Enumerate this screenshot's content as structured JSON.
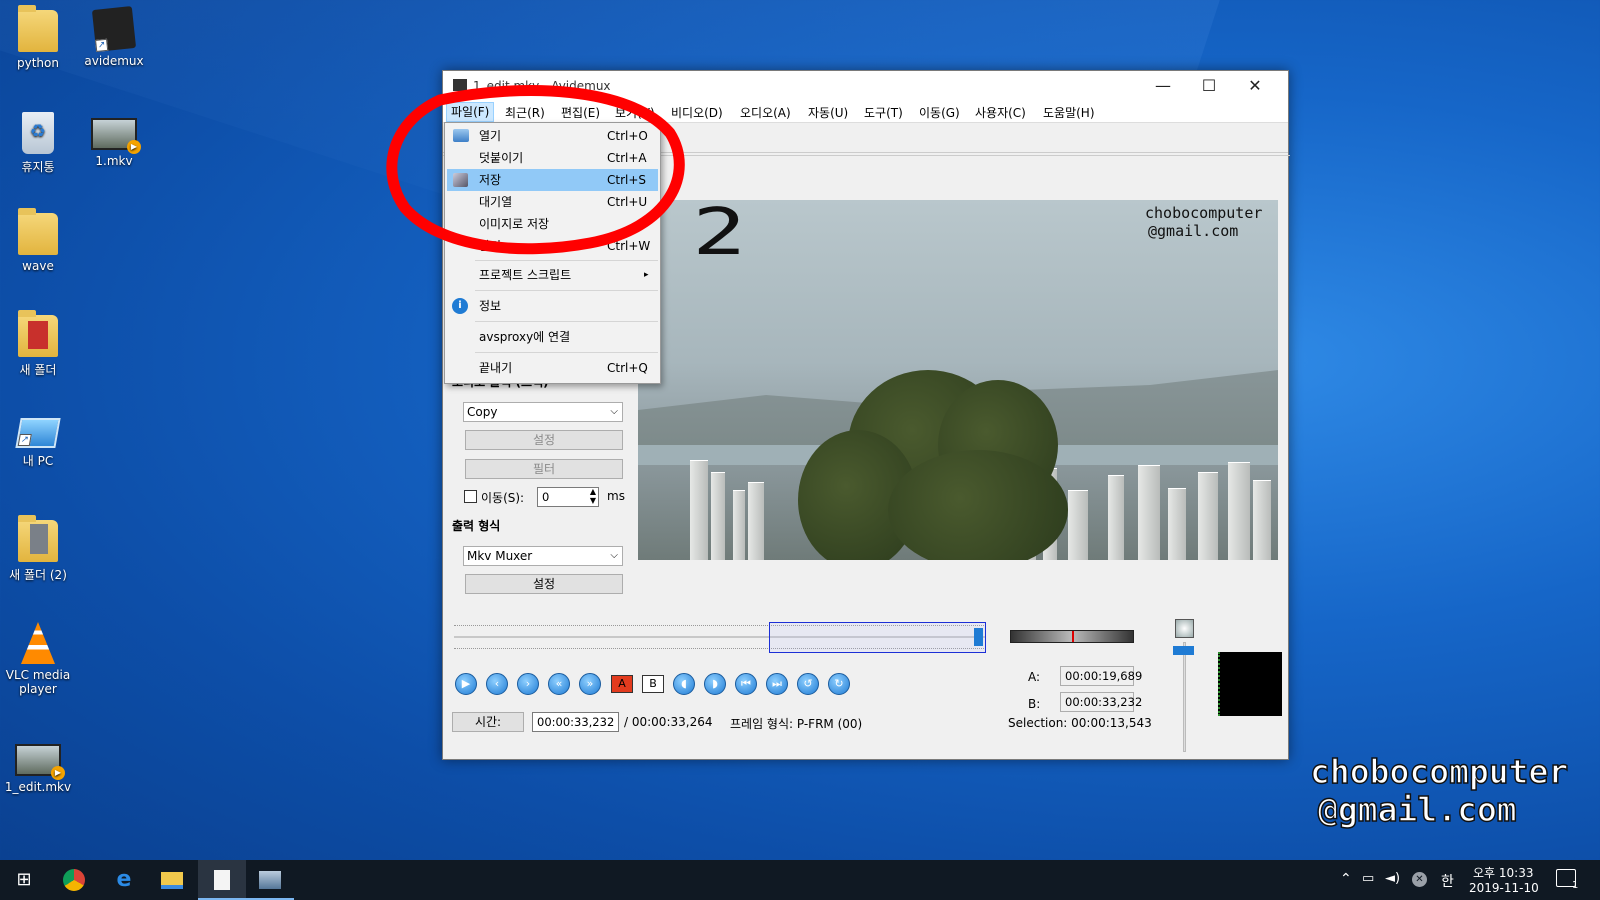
{
  "desktop": {
    "icons": [
      {
        "label": "python",
        "kind": "folder"
      },
      {
        "label": "avidemux",
        "kind": "app"
      },
      {
        "label": "휴지통",
        "kind": "recycle"
      },
      {
        "label": "1.mkv",
        "kind": "video"
      },
      {
        "label": "wave",
        "kind": "folder"
      },
      {
        "label": "새 폴더",
        "kind": "folder"
      },
      {
        "label": "내 PC",
        "kind": "pc"
      },
      {
        "label": "새 폴더 (2)",
        "kind": "folder"
      },
      {
        "label": "VLC media player",
        "kind": "vlc"
      },
      {
        "label": "1_edit.mkv",
        "kind": "video"
      }
    ]
  },
  "window": {
    "title": "1_edit.mkv - Avidemux",
    "minimize_glyph": "—",
    "maximize_glyph": "☐",
    "close_glyph": "✕",
    "menu": [
      "파일(F)",
      "최근(R)",
      "편집(E)",
      "보기(V)",
      "비디오(D)",
      "오디오(A)",
      "자동(U)",
      "도구(T)",
      "이동(G)",
      "사용자(C)",
      "도움말(H)"
    ]
  },
  "file_menu": {
    "items": [
      {
        "label": "열기",
        "shortcut": "Ctrl+O"
      },
      {
        "label": "덧붙이기",
        "shortcut": "Ctrl+A"
      },
      {
        "label": "저장",
        "shortcut": "Ctrl+S",
        "highlighted": true
      },
      {
        "label": "대기열",
        "shortcut": "Ctrl+U"
      },
      {
        "label": "이미지로 저장",
        "shortcut": "▸"
      },
      {
        "label": "닫기",
        "shortcut": "Ctrl+W"
      },
      {
        "label": "프로젝트 스크립트",
        "shortcut": "▸"
      },
      {
        "label": "정보",
        "shortcut": ""
      },
      {
        "label": "avsproxy에 연결",
        "shortcut": ""
      },
      {
        "label": "끝내기",
        "shortcut": "Ctrl+Q"
      }
    ]
  },
  "left_panel": {
    "audio_output_label": "오디오 출력 (트랙)",
    "audio_codec": "Copy",
    "settings_label": "설정",
    "filter_label": "필터",
    "shift_label": "이동(S):",
    "shift_value": "0",
    "shift_unit": "ms",
    "output_format_label": "출력 형식",
    "muxer": "Mkv Muxer",
    "muxer_settings_label": "설정"
  },
  "controls": {
    "time_button": "시간:",
    "current_time": "00:00:33,232",
    "total_time": "/ 00:00:33,264",
    "frame_type": "프레임 형식: P-FRM (00)",
    "a_label": "A:",
    "a_time": "00:00:19,689",
    "b_label": "B:",
    "b_time": "00:00:33,232",
    "selection": "Selection: 00:00:13,543",
    "marker_a_glyph": "A",
    "marker_b_glyph": "B"
  },
  "annotations": {
    "step_number": "2",
    "watermark_line1": "chobocomputer",
    "watermark_line2": "@gmail.com",
    "circle_color": "#ff0000"
  },
  "taskbar": {
    "ime": "한",
    "time": "오후 10:33",
    "date": "2019-11-10",
    "notification_count": "1"
  }
}
